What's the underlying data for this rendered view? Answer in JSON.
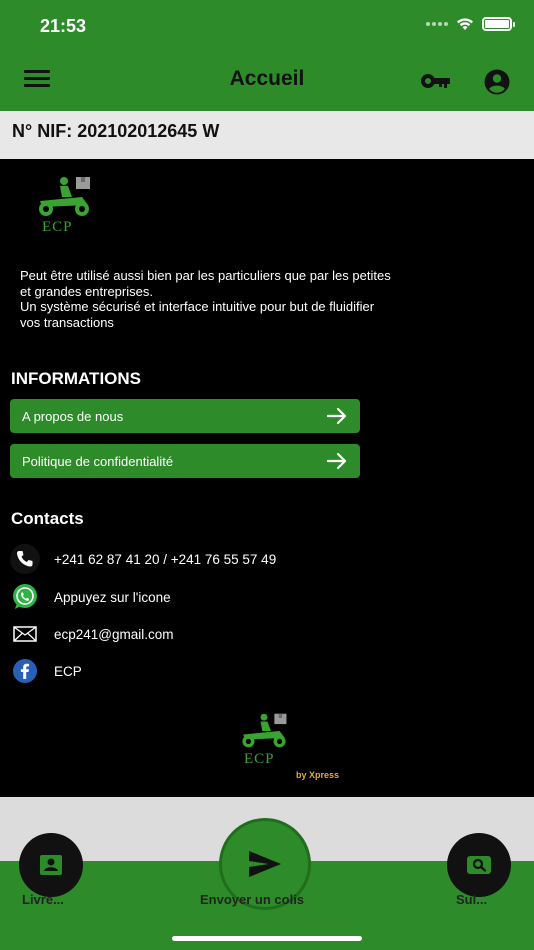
{
  "status_bar": {
    "time": "21:53"
  },
  "header": {
    "title": "Accueil",
    "menu_icon": "hamburger-menu-icon",
    "key_icon": "key-icon",
    "user_icon": "account-circle-icon"
  },
  "nif": {
    "label": "N° NIF: 202102012645 W"
  },
  "brand": {
    "logo_text": "ECP",
    "by_text": "by Xpress"
  },
  "description": "Peut être utilisé aussi bien par les particuliers que par les petites\net grandes entreprises.\n  Un système sécurisé et interface intuitive pour but de fluidifier\nvos transactions",
  "informations": {
    "title": "INFORMATIONS",
    "items": [
      {
        "label": "A propos de nous",
        "icon": "arrow-right-icon"
      },
      {
        "label": "Politique de confidentialité",
        "icon": "arrow-right-icon"
      }
    ]
  },
  "contacts": {
    "title": "Contacts",
    "items": [
      {
        "icon": "phone-icon",
        "text": "+241 62 87 41 20 / +241 76 55 57 49"
      },
      {
        "icon": "whatsapp-icon",
        "text": "Appuyez sur l'icone"
      },
      {
        "icon": "mail-icon",
        "text": "ecp241@gmail.com"
      },
      {
        "icon": "facebook-icon",
        "text": "ECP"
      }
    ]
  },
  "tabbar": {
    "left": {
      "label": "Livre...",
      "icon": "contact-card-icon"
    },
    "center": {
      "label": "Envoyer un colis",
      "icon": "send-icon"
    },
    "right": {
      "label": "Sui...",
      "icon": "search-card-icon"
    }
  },
  "colors": {
    "primary": "#2e8b2a",
    "background": "#000000",
    "bar": "#e8e8e8",
    "accent": "#e2a83a"
  }
}
